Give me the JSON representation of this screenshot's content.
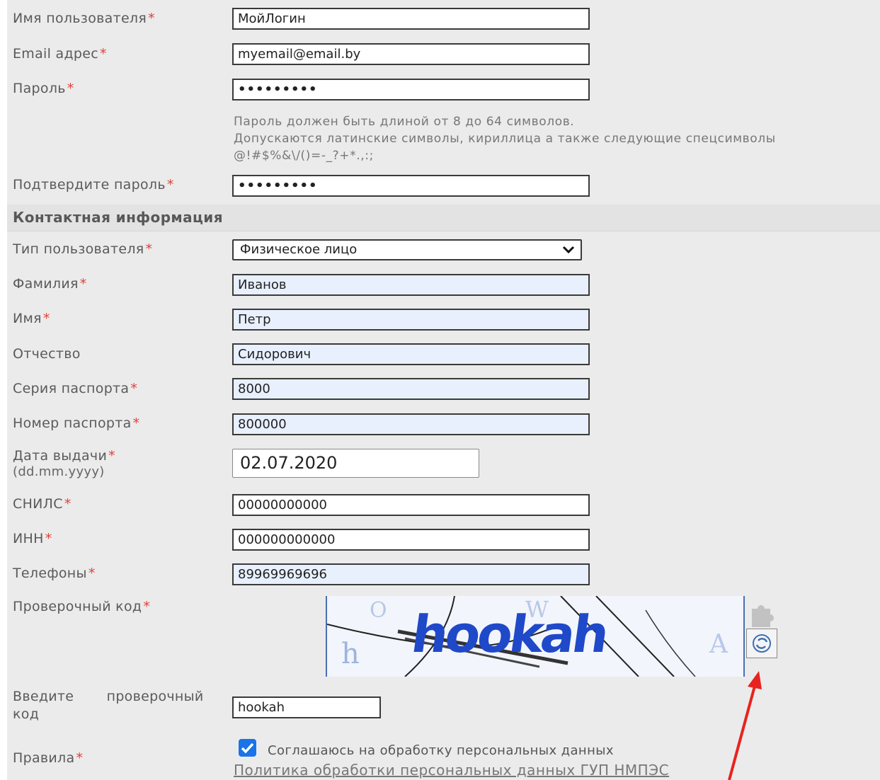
{
  "account": {
    "username_label": "Имя пользователя",
    "username_value": "МойЛогин",
    "email_label": "Email адрес",
    "email_value": "myemail@email.by",
    "password_label": "Пароль",
    "password_value": "•••••••••",
    "password_hint_1": "Пароль должен быть длиной от 8 до 64 символов.",
    "password_hint_2": "Допускаются латинские символы, кириллица а также следующие спецсимволы",
    "password_hint_3": "@!#$%&\\/()=-_?+*.,:;",
    "confirm_label": "Подтвердите пароль",
    "confirm_value": "•••••••••",
    "required_mark": "*"
  },
  "contact": {
    "section_title": "Контактная информация",
    "user_type_label": "Тип пользователя",
    "user_type_selected": "Физическое лицо",
    "lastname_label": "Фамилия",
    "lastname_value": "Иванов",
    "firstname_label": "Имя",
    "firstname_value": "Петр",
    "patronymic_label": "Отчество",
    "patronymic_value": "Сидорович",
    "passport_series_label": "Серия паспорта",
    "passport_series_value": "8000",
    "passport_number_label": "Номер паспорта",
    "passport_number_value": "800000",
    "issue_date_label": "Дата выдачи",
    "issue_date_format": "(dd.mm.yyyy)",
    "issue_date_value": "02.07.2020",
    "snils_label": "СНИЛС",
    "snils_value": "00000000000",
    "inn_label": "ИНН",
    "inn_value": "000000000000",
    "phones_label": "Телефоны",
    "phones_value": "89969969696"
  },
  "captcha": {
    "label": "Проверочный код",
    "image_word": "hookah",
    "input_label_1": "Введите проверочный",
    "input_label_2": "код",
    "input_value": "hookah",
    "refresh_icon": "refresh-icon",
    "plugin_icon": "puzzle-icon"
  },
  "rules": {
    "label": "Правила",
    "checkbox_checked": true,
    "consent_text": "Соглашаюсь на обработку персональных данных",
    "policy_link": "Политика обработки персональных данных ГУП НМПЭС"
  },
  "colors": {
    "required": "#e0413a",
    "autofill_bg": "#e8f0fe",
    "checkbox": "#1a73e8",
    "captcha_text": "#1f49c9",
    "annotation_arrow": "#e8231f"
  }
}
